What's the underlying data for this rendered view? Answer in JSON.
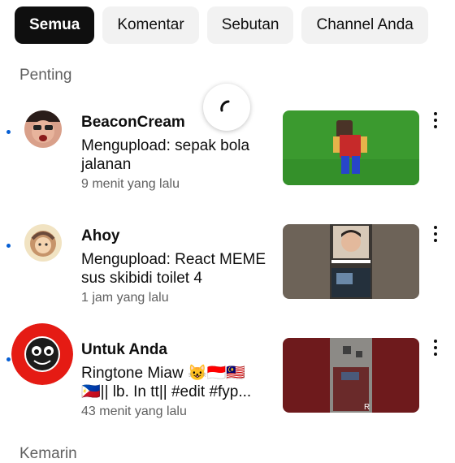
{
  "filters": [
    {
      "label": "Semua",
      "active": true
    },
    {
      "label": "Komentar",
      "active": false
    },
    {
      "label": "Sebutan",
      "active": false
    },
    {
      "label": "Channel Anda",
      "active": false
    }
  ],
  "section_title": "Penting",
  "next_section_title": "Kemarin",
  "notifications": [
    {
      "channel": "BeaconCream",
      "text": "Mengupload: sepak bola jalanan",
      "time": "9 menit yang lalu",
      "unread": true
    },
    {
      "channel": "Ahoy",
      "text": "Mengupload: React MEME sus skibidi toilet 4",
      "time": "1 jam yang lalu",
      "unread": true
    },
    {
      "channel": "Untuk Anda",
      "text": "Ringtone Miaw 😺🇮🇩🇲🇾🇵🇭|| lb. In tt|| #edit #fyp...",
      "time": "43 menit yang lalu",
      "unread": true
    }
  ],
  "colors": {
    "accent": "#065fd4",
    "chip_active": "#0f0f0f",
    "chip_bg": "#f2f2f2"
  },
  "icons": [
    "loading-spinner-icon",
    "more-vert-icon"
  ]
}
